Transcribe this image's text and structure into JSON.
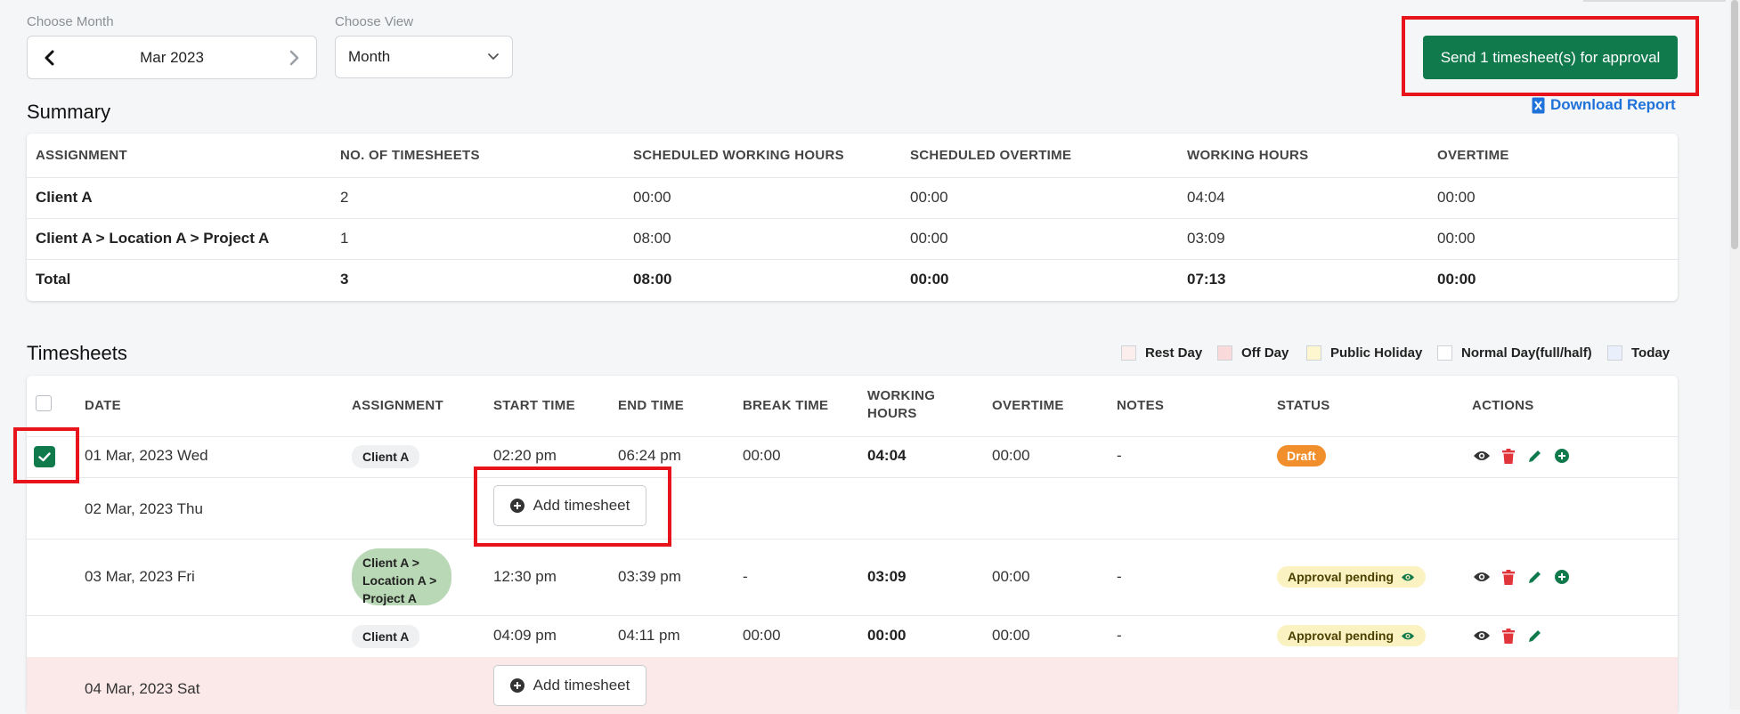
{
  "controls": {
    "month_label": "Choose Month",
    "month_value": "Mar 2023",
    "view_label": "Choose View",
    "view_value": "Month"
  },
  "actions": {
    "send_approval": "Send 1 timesheet(s) for approval",
    "download_report": "Download Report"
  },
  "summary": {
    "title": "Summary",
    "headers": [
      "ASSIGNMENT",
      "NO. OF TIMESHEETS",
      "SCHEDULED WORKING HOURS",
      "SCHEDULED OVERTIME",
      "WORKING HOURS",
      "OVERTIME"
    ],
    "rows": [
      {
        "assignment": "Client A",
        "count": "2",
        "sched_hours": "00:00",
        "sched_ot": "00:00",
        "hours": "04:04",
        "ot": "00:00"
      },
      {
        "assignment": "Client A > Location A > Project A",
        "count": "1",
        "sched_hours": "08:00",
        "sched_ot": "00:00",
        "hours": "03:09",
        "ot": "00:00"
      },
      {
        "assignment": "Total",
        "count": "3",
        "sched_hours": "08:00",
        "sched_ot": "00:00",
        "hours": "07:13",
        "ot": "00:00"
      }
    ]
  },
  "timesheets": {
    "title": "Timesheets",
    "legend": [
      {
        "label": "Rest Day",
        "color": "#fdeeee"
      },
      {
        "label": "Off Day",
        "color": "#f9d9d9"
      },
      {
        "label": "Public Holiday",
        "color": "#fdf6cf"
      },
      {
        "label": "Normal Day(full/half)",
        "color": "#ffffff"
      },
      {
        "label": "Today",
        "color": "#e9f0fb"
      }
    ],
    "headers": {
      "date": "DATE",
      "assignment": "ASSIGNMENT",
      "start": "START TIME",
      "end": "END TIME",
      "break": "BREAK TIME",
      "working_line1": "WORKING",
      "working_line2": "HOURS",
      "overtime": "OVERTIME",
      "notes": "NOTES",
      "status": "STATUS",
      "actions": "ACTIONS"
    },
    "rows": [
      {
        "date": "01 Mar, 2023 Wed",
        "assignment": "Client A",
        "start": "02:20 pm",
        "end": "06:24 pm",
        "break": "00:00",
        "hours": "04:04",
        "overtime": "00:00",
        "notes": "-",
        "status": "Draft"
      },
      {
        "date": "02 Mar, 2023 Thu",
        "add_label": "Add timesheet"
      },
      {
        "date": "03 Mar, 2023 Fri",
        "assignment_lines": [
          "Client A >",
          "Location A >",
          "Project A"
        ],
        "start": "12:30 pm",
        "end": "03:39 pm",
        "break": "-",
        "hours": "03:09",
        "overtime": "00:00",
        "notes": "-",
        "status": "Approval pending"
      },
      {
        "assignment": "Client A",
        "start": "04:09 pm",
        "end": "04:11 pm",
        "break": "00:00",
        "hours": "00:00",
        "overtime": "00:00",
        "notes": "-",
        "status": "Approval pending"
      },
      {
        "date": "04 Mar, 2023 Sat",
        "add_label": "Add timesheet"
      }
    ]
  },
  "colors": {
    "primary": "#117a4d",
    "link": "#1e72d9",
    "highlight": "#e8141c",
    "draft": "#f08f2c",
    "pending_bg": "#fbf2c2",
    "delete": "#e0353a",
    "edit": "#117a4d"
  }
}
